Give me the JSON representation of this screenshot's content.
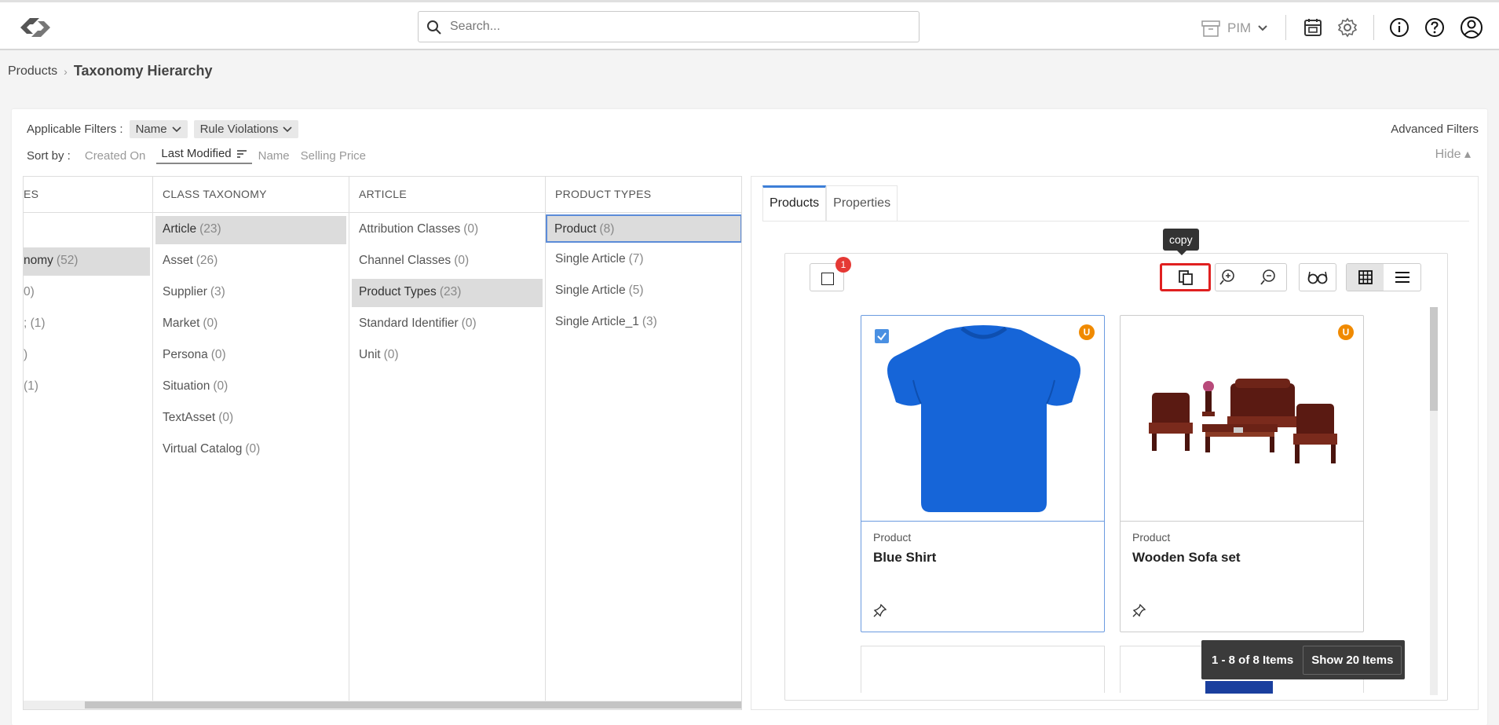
{
  "header": {
    "search_placeholder": "Search...",
    "app_switcher": "PIM",
    "icons": [
      "app-logo-icon",
      "search-icon",
      "archive-icon",
      "chevron-down-icon",
      "calendar-box-icon",
      "gear-icon",
      "info-icon",
      "help-icon",
      "user-icon"
    ]
  },
  "breadcrumb": {
    "root": "Products",
    "separator": "›",
    "current": "Taxonomy Hierarchy"
  },
  "filters": {
    "label": "Applicable Filters :",
    "chips": [
      "Name",
      "Rule Violations"
    ],
    "advanced": "Advanced Filters"
  },
  "sort": {
    "label": "Sort by :",
    "options": [
      "Created On",
      "Last Modified",
      "Name",
      "Selling Price"
    ],
    "active": "Last Modified",
    "hide": "Hide ▴"
  },
  "columns": [
    {
      "header": "ES",
      "items": [
        {
          "label": "",
          "count": ""
        },
        {
          "label": "nomy",
          "count": "(52)",
          "selected": true
        },
        {
          "label": "",
          "count": "0)"
        },
        {
          "label": "",
          "count": "; (1)"
        },
        {
          "label": "",
          "count": ")"
        },
        {
          "label": "",
          "count": "(1)"
        }
      ]
    },
    {
      "header": "CLASS TAXONOMY",
      "items": [
        {
          "label": "Article",
          "count": "(23)",
          "selected": true
        },
        {
          "label": "Asset",
          "count": "(26)"
        },
        {
          "label": "Supplier",
          "count": "(3)"
        },
        {
          "label": "Market",
          "count": "(0)"
        },
        {
          "label": "Persona",
          "count": "(0)"
        },
        {
          "label": "Situation",
          "count": "(0)"
        },
        {
          "label": "TextAsset",
          "count": "(0)"
        },
        {
          "label": "Virtual Catalog",
          "count": "(0)"
        }
      ]
    },
    {
      "header": "ARTICLE",
      "items": [
        {
          "label": "Attribution Classes",
          "count": "(0)"
        },
        {
          "label": "Channel Classes",
          "count": "(0)"
        },
        {
          "label": "Product Types",
          "count": "(23)",
          "selected": true
        },
        {
          "label": "Standard Identifier",
          "count": "(0)"
        },
        {
          "label": "Unit",
          "count": "(0)"
        }
      ]
    },
    {
      "header": "PRODUCT TYPES",
      "items": [
        {
          "label": "Product",
          "count": "(8)",
          "selected": true,
          "focused": true
        },
        {
          "label": "Single Article",
          "count": "(7)"
        },
        {
          "label": "Single Article",
          "count": "(5)"
        },
        {
          "label": "Single Article_1",
          "count": "(3)"
        }
      ]
    }
  ],
  "panel": {
    "tabs": [
      "Products",
      "Properties"
    ],
    "active_tab": "Products",
    "selected_count": "1",
    "tooltip": "copy",
    "view_mode": "grid",
    "products": [
      {
        "type": "Product",
        "name": "Blue Shirt",
        "status_badge": "U",
        "checked": true
      },
      {
        "type": "Product",
        "name": "Wooden Sofa set",
        "status_badge": "U",
        "checked": false
      }
    ],
    "pager": {
      "range": "1 - 8 of 8 Items",
      "show_button": "Show 20 Items"
    }
  },
  "colors": {
    "accent": "#3d7fd7",
    "highlight_red": "#e02020",
    "badge_red": "#e53935",
    "badge_orange": "#f08a00",
    "shirt_blue": "#1665d8"
  }
}
